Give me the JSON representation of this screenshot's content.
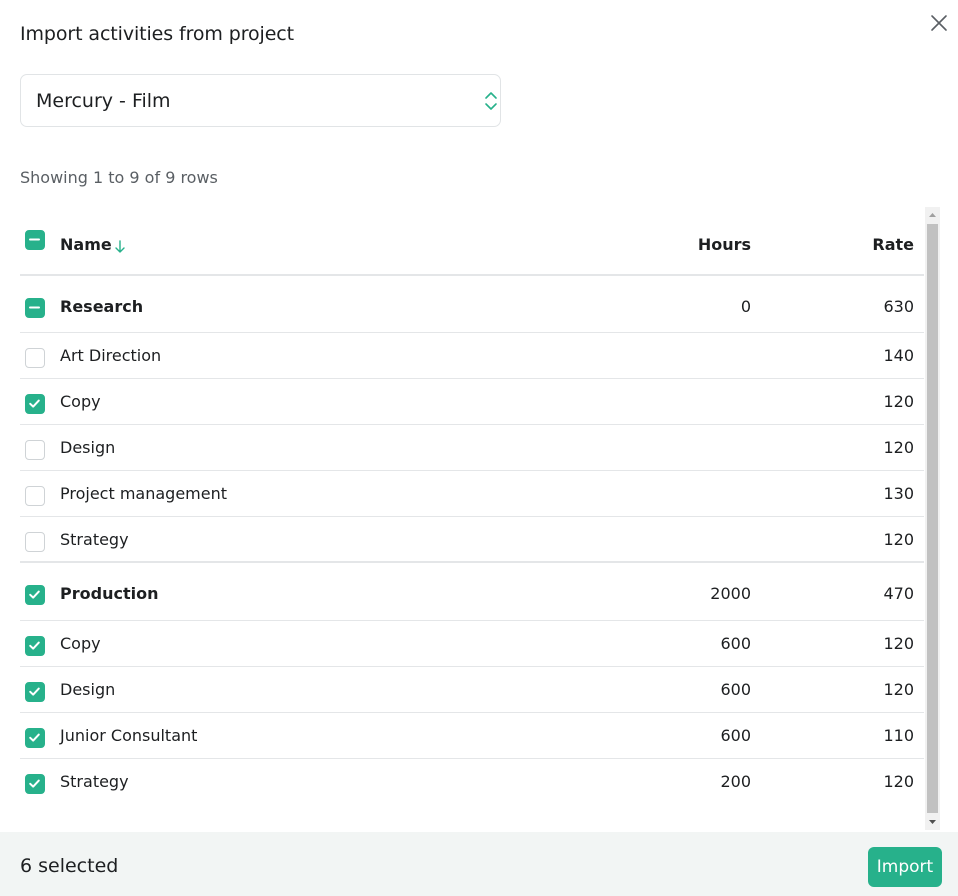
{
  "modal": {
    "title": "Import activities from project",
    "project_select": {
      "value": "Mercury - Film"
    },
    "rows_info": "Showing 1 to 9 of 9 rows"
  },
  "table": {
    "headers": {
      "name": "Name",
      "hours": "Hours",
      "rate": "Rate"
    },
    "rows": [
      {
        "name": "Research",
        "hours": "0",
        "rate": "630",
        "group": true,
        "state": "partial"
      },
      {
        "name": "Art Direction",
        "hours": "",
        "rate": "140",
        "group": false,
        "state": "unchecked"
      },
      {
        "name": "Copy",
        "hours": "",
        "rate": "120",
        "group": false,
        "state": "checked"
      },
      {
        "name": "Design",
        "hours": "",
        "rate": "120",
        "group": false,
        "state": "unchecked"
      },
      {
        "name": "Project management",
        "hours": "",
        "rate": "130",
        "group": false,
        "state": "unchecked"
      },
      {
        "name": "Strategy",
        "hours": "",
        "rate": "120",
        "group": false,
        "state": "unchecked"
      },
      {
        "name": "Production",
        "hours": "2000",
        "rate": "470",
        "group": true,
        "state": "checked"
      },
      {
        "name": "Copy",
        "hours": "600",
        "rate": "120",
        "group": false,
        "state": "checked"
      },
      {
        "name": "Design",
        "hours": "600",
        "rate": "120",
        "group": false,
        "state": "checked"
      },
      {
        "name": "Junior Consultant",
        "hours": "600",
        "rate": "110",
        "group": false,
        "state": "checked"
      },
      {
        "name": "Strategy",
        "hours": "200",
        "rate": "120",
        "group": false,
        "state": "checked"
      }
    ]
  },
  "footer": {
    "selected_count": "6 selected",
    "import_label": "Import"
  },
  "colors": {
    "accent": "#27b18b",
    "footer_bg": "#f2f5f4",
    "border": "#e4e6e8"
  },
  "icons": {
    "close": "close-icon",
    "select_chevron": "chevron-up-down-icon",
    "sort": "arrow-down-icon",
    "check": "check-icon",
    "partial": "minus-icon"
  }
}
